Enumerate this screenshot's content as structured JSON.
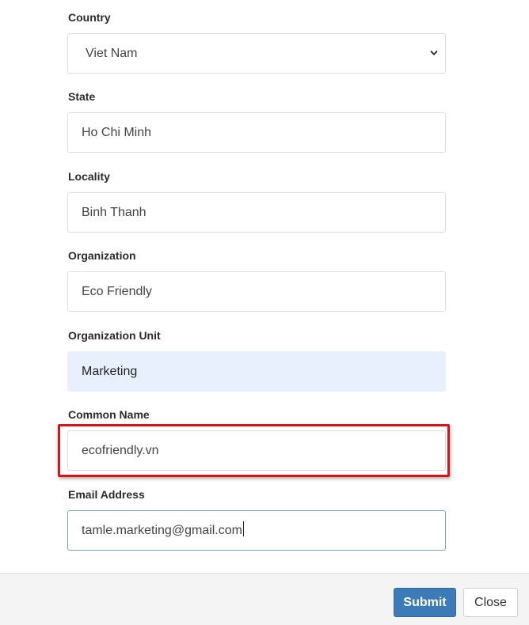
{
  "form": {
    "country": {
      "label": "Country",
      "value": "Viet Nam"
    },
    "state": {
      "label": "State",
      "value": "Ho Chi Minh"
    },
    "locality": {
      "label": "Locality",
      "value": "Binh Thanh"
    },
    "organization": {
      "label": "Organization",
      "value": "Eco Friendly"
    },
    "organization_unit": {
      "label": "Organization Unit",
      "value": "Marketing"
    },
    "common_name": {
      "label": "Common Name",
      "value": "ecofriendly.vn"
    },
    "email": {
      "label": "Email Address",
      "value": "tamle.marketing@gmail.com"
    }
  },
  "footer": {
    "submit_label": "Submit",
    "close_label": "Close"
  },
  "colors": {
    "primary": "#3c7bb8",
    "autofill": "#e8f0fe",
    "highlight": "#d8141b"
  },
  "icons": {
    "country_select": "chevron-down-icon"
  }
}
